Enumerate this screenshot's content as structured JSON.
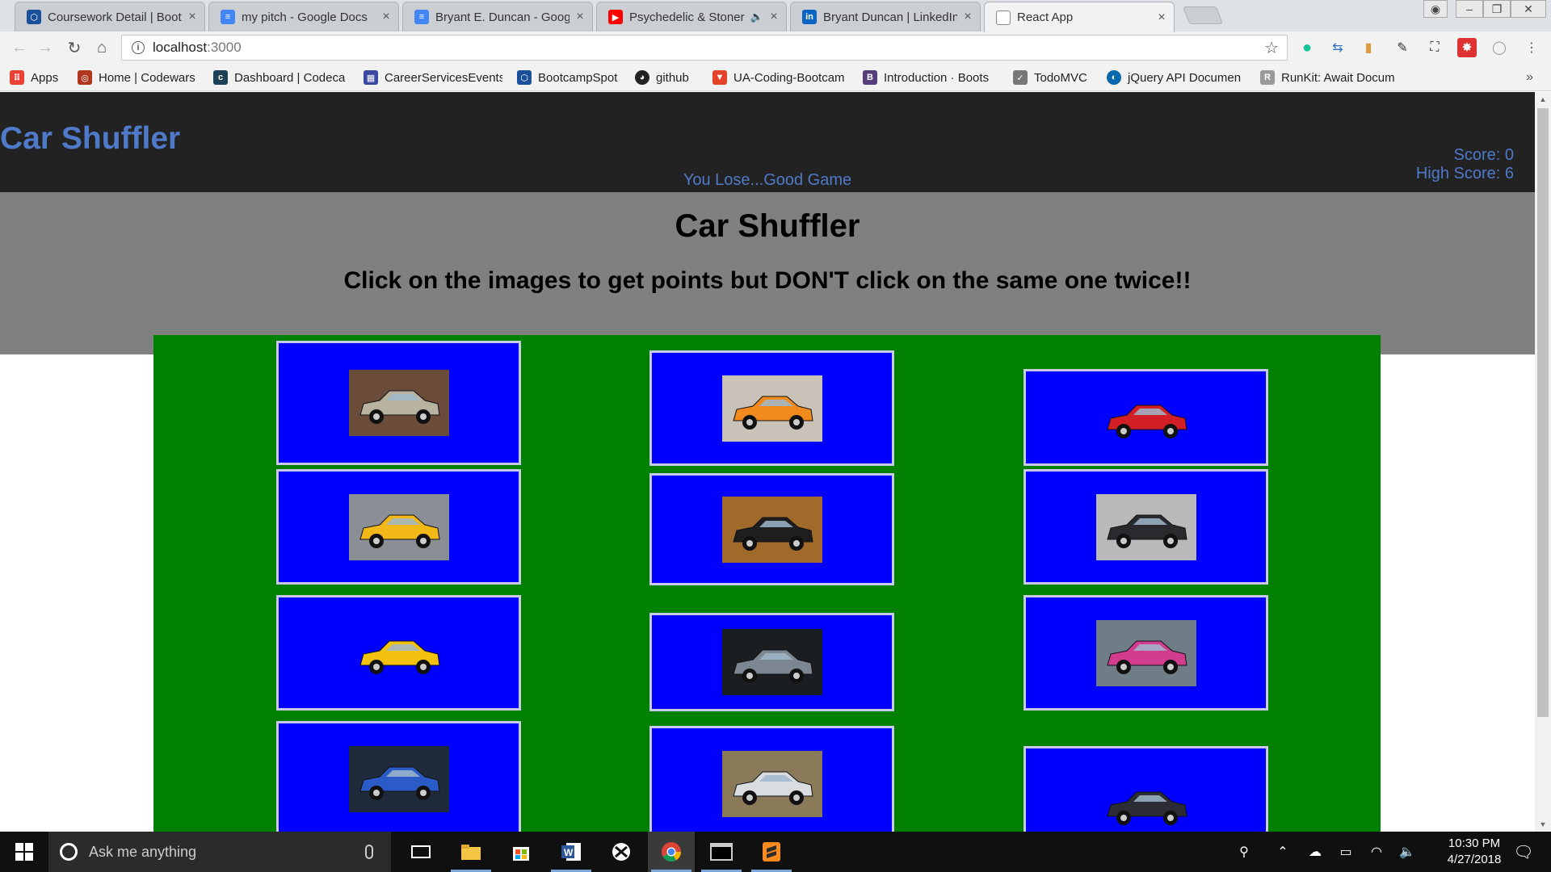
{
  "browser": {
    "tabs": [
      {
        "label": "Coursework Detail | Boot",
        "favicon": "bootcamp-icon",
        "color": "#1a4f9c",
        "active": false
      },
      {
        "label": "my pitch - Google Docs",
        "favicon": "google-docs-icon",
        "color": "#4285f4",
        "active": false
      },
      {
        "label": "Bryant E. Duncan - Googl",
        "favicon": "google-docs-icon",
        "color": "#4285f4",
        "active": false
      },
      {
        "label": "Psychedelic & Stoner",
        "favicon": "youtube-icon",
        "color": "#ff0000",
        "active": false
      },
      {
        "label": "Bryant Duncan | LinkedIn",
        "favicon": "linkedin-icon",
        "color": "#0a66c2",
        "active": false
      },
      {
        "label": "React App",
        "favicon": "page-icon",
        "color": "#ffffff",
        "active": true
      }
    ],
    "close_glyph": "×",
    "address": {
      "host": "localhost",
      "port": ":3000"
    }
  },
  "bookmarks": [
    {
      "label": "Apps",
      "icon": "apps-grid-icon",
      "color": "#e94235"
    },
    {
      "label": "Home | Codewars",
      "icon": "codewars-icon",
      "color": "#b1361e"
    },
    {
      "label": "Dashboard | Codeca",
      "icon": "codecademy-icon",
      "color": "#204056"
    },
    {
      "label": "CareerServicesEvents",
      "icon": "calendar-icon",
      "color": "#3b4aa0"
    },
    {
      "label": "BootcampSpot",
      "icon": "bootcamp-icon",
      "color": "#1a4f9c"
    },
    {
      "label": "github",
      "icon": "github-icon",
      "color": "#222222"
    },
    {
      "label": "UA-Coding-Bootcam",
      "icon": "gitlab-icon",
      "color": "#e24329"
    },
    {
      "label": "Introduction · Boots",
      "icon": "bootstrap-icon",
      "color": "#563d7c"
    },
    {
      "label": "TodoMVC",
      "icon": "checklist-icon",
      "color": "#777777"
    },
    {
      "label": "jQuery API Documen",
      "icon": "jquery-icon",
      "color": "#0769ad"
    },
    {
      "label": "RunKit: Await Docum",
      "icon": "runkit-icon",
      "color": "#999999"
    }
  ],
  "app": {
    "brand": "Car Shuffler",
    "message": "You Lose...Good Game",
    "score_text": "Score: 0",
    "high_score_text": "High Score: 6",
    "heading": "Car Shuffler",
    "instructions": "Click on the images to get points but DON'T click on the same one twice!!",
    "colors": {
      "navbar": "#222222",
      "accent": "#4f7ac9",
      "jumbotron": "#808080",
      "container": "#008000",
      "card": "#0000ff"
    },
    "cards": [
      {
        "name": "vintage-touring-car",
        "body": "#b8b2a0",
        "bg": "#6b4b3a"
      },
      {
        "name": "orange-supercar",
        "body": "#f08a1c",
        "bg": "#c9c2b8"
      },
      {
        "name": "red-convertible",
        "body": "#d21f26",
        "bg": "#0000ff"
      },
      {
        "name": "yellow-sports-car",
        "body": "#f2b817",
        "bg": "#8a8f96"
      },
      {
        "name": "black-vintage-car",
        "body": "#1e1e1e",
        "bg": "#a06a2a"
      },
      {
        "name": "black-supercar",
        "body": "#2a2a2e",
        "bg": "#b9b9b9"
      },
      {
        "name": "yellow-rally-car",
        "body": "#f2c20f",
        "bg": "#0000ff"
      },
      {
        "name": "silver-sedan",
        "body": "#7b8690",
        "bg": "#1a1d22"
      },
      {
        "name": "pink-classic-car",
        "body": "#d23c8e",
        "bg": "#6e7d86"
      },
      {
        "name": "blue-beetle",
        "body": "#2a5bc6",
        "bg": "#1f2a3a"
      },
      {
        "name": "white-rally-car",
        "body": "#d9dde0",
        "bg": "#8a7a5a"
      },
      {
        "name": "black-wagon",
        "body": "#2c2c34",
        "bg": "#0000ff"
      }
    ]
  },
  "taskbar": {
    "search_placeholder": "Ask me anything",
    "time": "10:30 PM",
    "date": "4/27/2018"
  }
}
